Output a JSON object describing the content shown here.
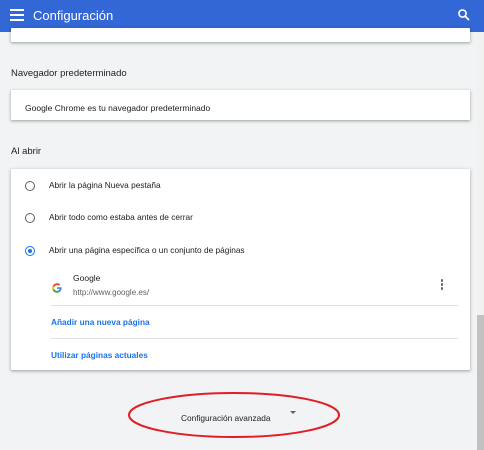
{
  "header": {
    "title": "Configuración",
    "menu_icon": "hamburger-menu-icon",
    "search_icon": "search-icon",
    "color": "#3367d6"
  },
  "default_browser": {
    "section_title": "Navegador predeterminado",
    "status_text": "Google Chrome es tu navegador predeterminado"
  },
  "on_startup": {
    "section_title": "Al abrir",
    "options": [
      {
        "label": "Abrir la página Nueva pestaña",
        "checked": false
      },
      {
        "label": "Abrir todo como estaba antes de cerrar",
        "checked": false
      },
      {
        "label": "Abrir una página específica o un conjunto de páginas",
        "checked": true
      }
    ],
    "pages": [
      {
        "name": "Google",
        "url": "http://www.google.es/",
        "icon": "google-favicon-icon"
      }
    ],
    "add_page_link": "Añadir una nueva página",
    "use_current_link": "Utilizar páginas actuales"
  },
  "advanced": {
    "label": "Configuración avanzada",
    "icon": "chevron-down-icon"
  },
  "annotation": {
    "shape": "ellipse",
    "color": "#e01e25"
  }
}
